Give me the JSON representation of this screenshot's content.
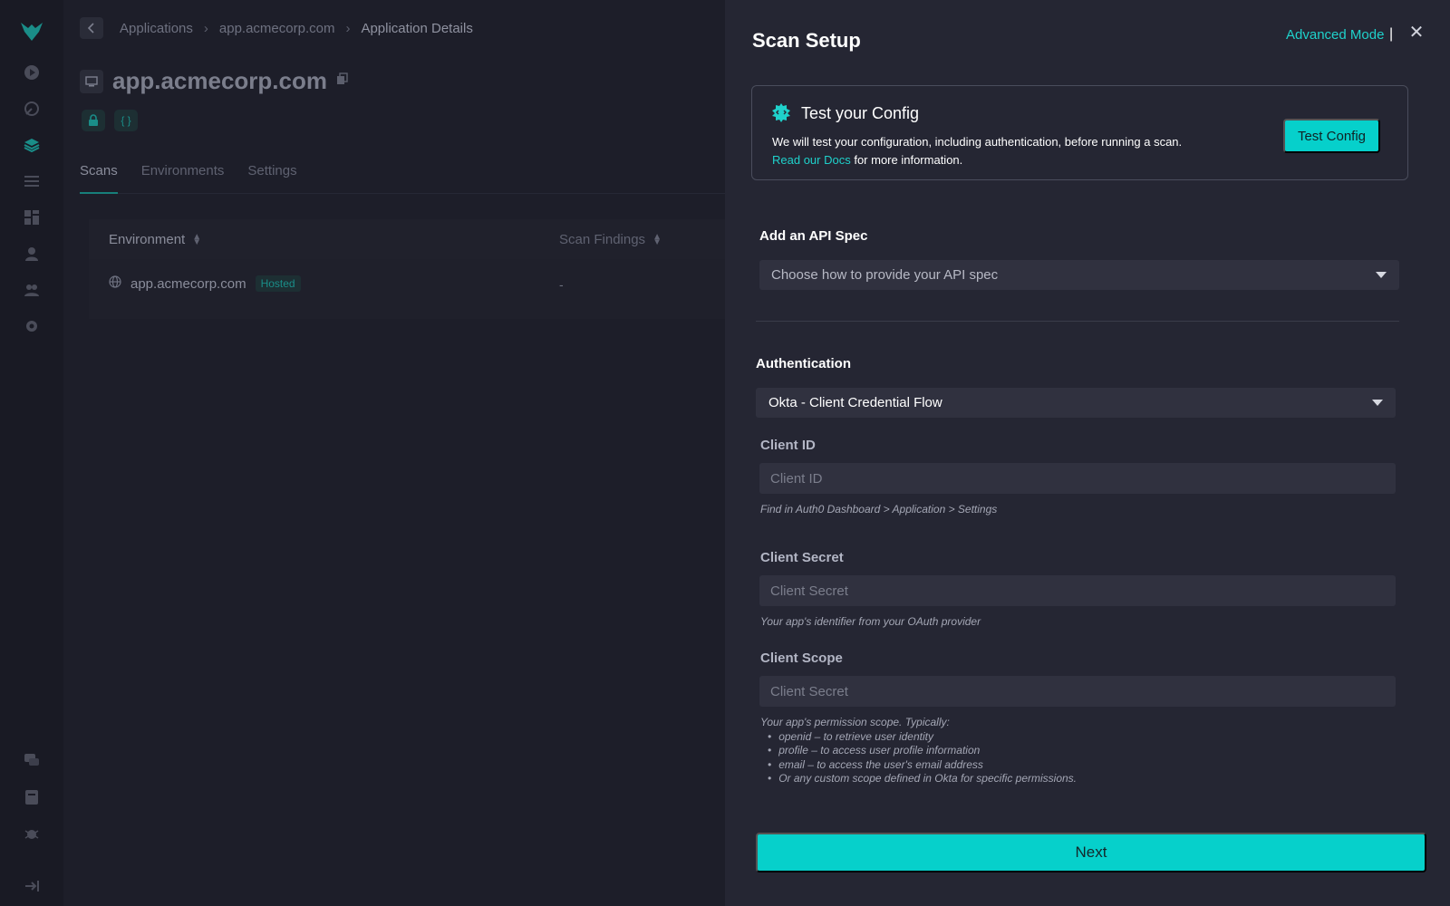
{
  "breadcrumb": [
    "Applications",
    "app.acmecorp.com",
    "Application Details"
  ],
  "app": {
    "title": "app.acmecorp.com"
  },
  "tabs": [
    "Scans",
    "Environments",
    "Settings"
  ],
  "table": {
    "headers": {
      "environment": "Environment",
      "scan_findings": "Scan Findings"
    },
    "rows": [
      {
        "environment": "app.acmecorp.com",
        "badge": "Hosted",
        "findings": "-"
      }
    ]
  },
  "drawer": {
    "title": "Scan Setup",
    "advanced_mode": "Advanced Mode",
    "separator": "|",
    "test_config": {
      "title": "Test your Config",
      "description": "We will test your configuration, including authentication, before running a scan.",
      "link": "Read our Docs",
      "suffix": " for more information.",
      "button": "Test Config"
    },
    "api_spec": {
      "label": "Add an API Spec",
      "placeholder": "Choose how to provide your API spec"
    },
    "auth": {
      "label": "Authentication",
      "selected": "Okta - Client Credential Flow",
      "client_id": {
        "label": "Client ID",
        "placeholder": "Client ID",
        "hint": "Find in Auth0 Dashboard > Application > Settings"
      },
      "client_secret": {
        "label": "Client Secret",
        "placeholder": "Client Secret",
        "hint": "Your app's identifier from your OAuth provider"
      },
      "client_scope": {
        "label": "Client Scope",
        "placeholder": "Client Secret",
        "hint": "Your app's permission scope. Typically:",
        "items": [
          "openid – to retrieve user identity",
          "profile – to access user profile information",
          "email – to access the user's email address",
          "Or any custom scope defined in Okta for specific permissions."
        ]
      }
    },
    "next": "Next"
  },
  "colors": {
    "accent": "#06d0cb",
    "link": "#1fd1cb",
    "drawer_bg": "#252633",
    "page_bg": "#1d1e29"
  }
}
